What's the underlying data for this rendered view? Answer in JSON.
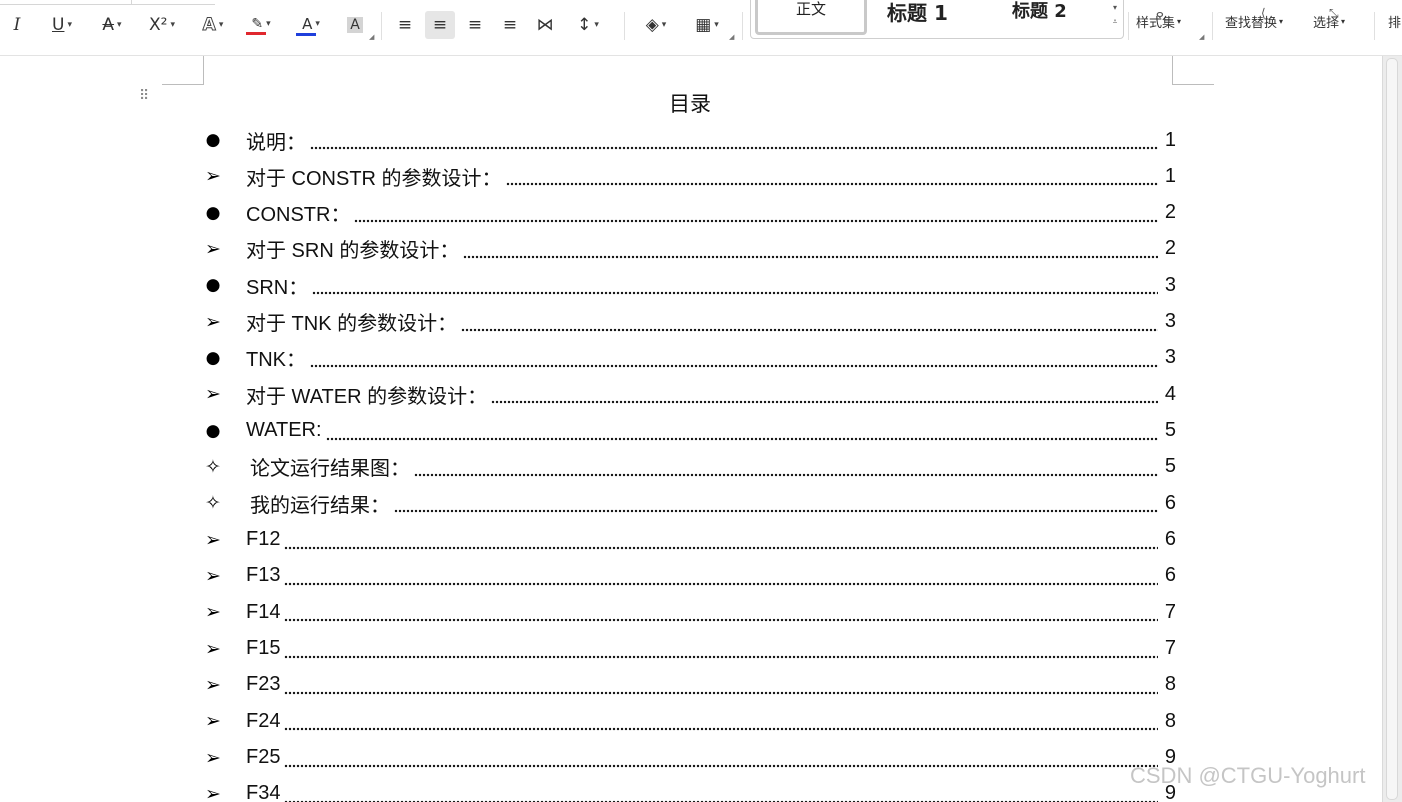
{
  "ribbon": {
    "font_tools": [
      {
        "name": "italic-button",
        "label": "I"
      },
      {
        "name": "underline-button",
        "label": "U"
      },
      {
        "name": "strikethrough-button",
        "label": "A"
      },
      {
        "name": "superscript-button",
        "label": "X²"
      },
      {
        "name": "text-effects-button",
        "label": "A"
      },
      {
        "name": "highlight-button",
        "label": "✎"
      },
      {
        "name": "font-color-button",
        "label": "A"
      },
      {
        "name": "char-shading-button",
        "label": "A"
      }
    ],
    "paragraph_tools": [
      {
        "name": "align-left-button",
        "label": "≡"
      },
      {
        "name": "align-center-button",
        "label": "≡"
      },
      {
        "name": "align-right-button",
        "label": "≡"
      },
      {
        "name": "justify-button",
        "label": "≡"
      },
      {
        "name": "distributed-button",
        "label": "⋈"
      },
      {
        "name": "line-spacing-button",
        "label": "↕"
      },
      {
        "name": "shading-button",
        "label": "◈"
      },
      {
        "name": "borders-button",
        "label": "▦"
      }
    ],
    "highlight_color": "#e0282e",
    "font_color": "#1f3fdc",
    "styles": {
      "normal": "正文",
      "heading1": "标题 1",
      "heading2": "标题 2",
      "styles_set": "样式集",
      "find_replace": "查找替换",
      "select": "选择",
      "arrange": "排"
    }
  },
  "document": {
    "toc_title": "目录",
    "toc": [
      {
        "bullet": "dot",
        "text": "说明：",
        "page": "1"
      },
      {
        "bullet": "arrow",
        "text": "对于 CONSTR 的参数设计：",
        "page": "1"
      },
      {
        "bullet": "dot",
        "text": "CONSTR：",
        "page": "2"
      },
      {
        "bullet": "arrow",
        "text": "对于 SRN 的参数设计：",
        "page": "2"
      },
      {
        "bullet": "dot",
        "text": "SRN：",
        "page": "3"
      },
      {
        "bullet": "arrow",
        "text": "对于 TNK 的参数设计：",
        "page": "3"
      },
      {
        "bullet": "dot",
        "text": "TNK：",
        "page": "3"
      },
      {
        "bullet": "arrow",
        "text": "对于 WATER 的参数设计：",
        "page": "4"
      },
      {
        "bullet": "dot",
        "text": "WATER:",
        "page": "5"
      },
      {
        "bullet": "star",
        "text": "论文运行结果图：",
        "page": "5"
      },
      {
        "bullet": "star",
        "text": "我的运行结果：",
        "page": "6"
      },
      {
        "bullet": "arrow",
        "text": "F12",
        "page": "6"
      },
      {
        "bullet": "arrow",
        "text": "F13",
        "page": "6"
      },
      {
        "bullet": "arrow",
        "text": "F14",
        "page": "7"
      },
      {
        "bullet": "arrow",
        "text": "F15",
        "page": "7"
      },
      {
        "bullet": "arrow",
        "text": "F23",
        "page": "8"
      },
      {
        "bullet": "arrow",
        "text": "F24",
        "page": "8"
      },
      {
        "bullet": "arrow",
        "text": "F25",
        "page": "9"
      },
      {
        "bullet": "arrow",
        "text": "F34",
        "page": "9"
      }
    ]
  },
  "watermark": "CSDN @CTGU-Yoghurt"
}
